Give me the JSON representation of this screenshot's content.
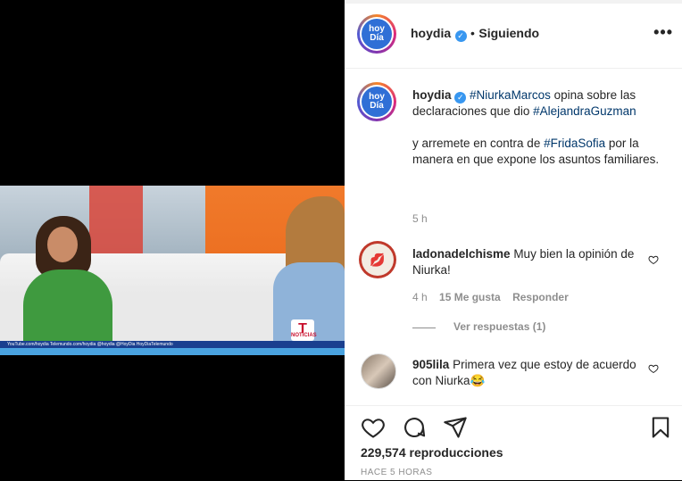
{
  "header": {
    "username": "hoydia",
    "avatar_text_line1": "hoy",
    "avatar_text_line2": "Día",
    "follow_status": "Siguiendo",
    "separator": "•",
    "more_label": "•••"
  },
  "video": {
    "ticker_text": "YouTube.com/hoydia   Telemundo.com/hoydia   @hoydia   @HoyDia   HoyDiaTelemundo",
    "logo_text": "NOTICIAS"
  },
  "caption": {
    "username": "hoydia",
    "tag1": "#NiurkaMarcos",
    "text1": " opina sobre las declaraciones que dio ",
    "tag2": "#AlejandraGuzman",
    "text2": "y arremete en contra de ",
    "tag3": "#FridaSofia",
    "text3": " por la manera en que expone los asuntos familiares.",
    "time": "5 h"
  },
  "comments": [
    {
      "username": "ladonadelchisme",
      "text": "Muy bien la opinión de Niurka!",
      "time": "4 h",
      "likes": "15 Me gusta",
      "reply_label": "Responder",
      "view_replies": "Ver respuestas (1)"
    },
    {
      "username": "905lila",
      "text": "Primera vez que estoy de acuerdo con Niurka😂"
    }
  ],
  "stats": {
    "views": "229,574 reproducciones",
    "time_ago": "HACE 5 HORAS"
  },
  "colors": {
    "link": "#00376b",
    "verified": "#3897f0",
    "brand_blue": "#2f6fd6",
    "muted": "#8e8e8e"
  }
}
